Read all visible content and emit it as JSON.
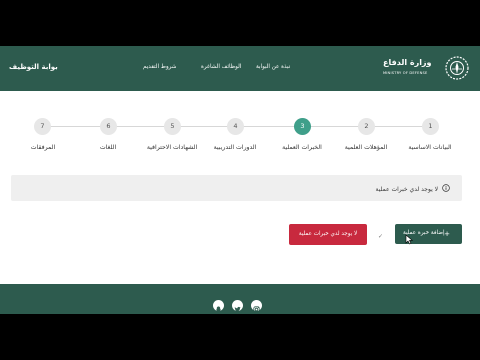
{
  "header": {
    "portal_title": "بوابة التوظيف",
    "nav": [
      {
        "label": "نبذة عن البوابة"
      },
      {
        "label": "الوظائف الشاغرة"
      },
      {
        "label": "شروط التقديم"
      }
    ],
    "logo_ar": "وزارة الدفاع",
    "logo_en": "MINISTRY OF DEFENSE"
  },
  "steps": [
    {
      "number": "1",
      "label": "البيانات الاساسية"
    },
    {
      "number": "2",
      "label": "المؤهلات العلمية"
    },
    {
      "number": "3",
      "label": "الخبرات العملية"
    },
    {
      "number": "4",
      "label": "الدورات التدريبية"
    },
    {
      "number": "5",
      "label": "الشهادات الاحترافية"
    },
    {
      "number": "6",
      "label": "اللغات"
    },
    {
      "number": "7",
      "label": "المرفقات"
    }
  ],
  "active_step": "3",
  "message": "لا يوجد لدي خبرات عملية",
  "buttons": {
    "add": "إضافة خبرة عملية",
    "none": "لا يوجد لدي خبرات عملية"
  },
  "footer": {
    "social": [
      "instagram-icon",
      "twitter-icon",
      "snapchat-icon"
    ]
  },
  "colors": {
    "primary": "#2d5b4e",
    "active_step": "#3f9f8a",
    "danger": "#c8293e"
  }
}
